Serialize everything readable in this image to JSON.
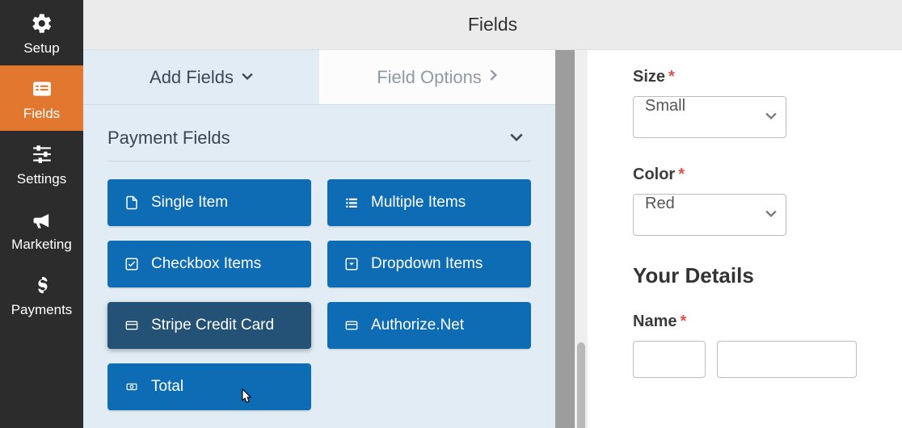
{
  "header": {
    "title": "Fields"
  },
  "sidebar": {
    "items": [
      {
        "label": "Setup",
        "icon": "gear-icon",
        "active": false
      },
      {
        "label": "Fields",
        "icon": "form-list-icon",
        "active": true
      },
      {
        "label": "Settings",
        "icon": "sliders-icon",
        "active": false
      },
      {
        "label": "Marketing",
        "icon": "bullhorn-icon",
        "active": false
      },
      {
        "label": "Payments",
        "icon": "dollar-icon",
        "active": false
      }
    ]
  },
  "tabs": {
    "add_fields": "Add Fields",
    "field_options": "Field Options"
  },
  "payment_section": {
    "title": "Payment Fields",
    "buttons": [
      {
        "label": "Single Item",
        "icon": "file-icon"
      },
      {
        "label": "Multiple Items",
        "icon": "list-icon"
      },
      {
        "label": "Checkbox Items",
        "icon": "checkbox-icon"
      },
      {
        "label": "Dropdown Items",
        "icon": "dropdown-icon"
      },
      {
        "label": "Stripe Credit Card",
        "icon": "credit-card-icon",
        "hovered": true
      },
      {
        "label": "Authorize.Net",
        "icon": "credit-card-icon"
      },
      {
        "label": "Total",
        "icon": "money-icon"
      }
    ]
  },
  "preview": {
    "size": {
      "label": "Size",
      "value": "Small"
    },
    "color": {
      "label": "Color",
      "value": "Red"
    },
    "details_heading": "Your Details",
    "name": {
      "label": "Name",
      "first": "",
      "last": ""
    }
  }
}
